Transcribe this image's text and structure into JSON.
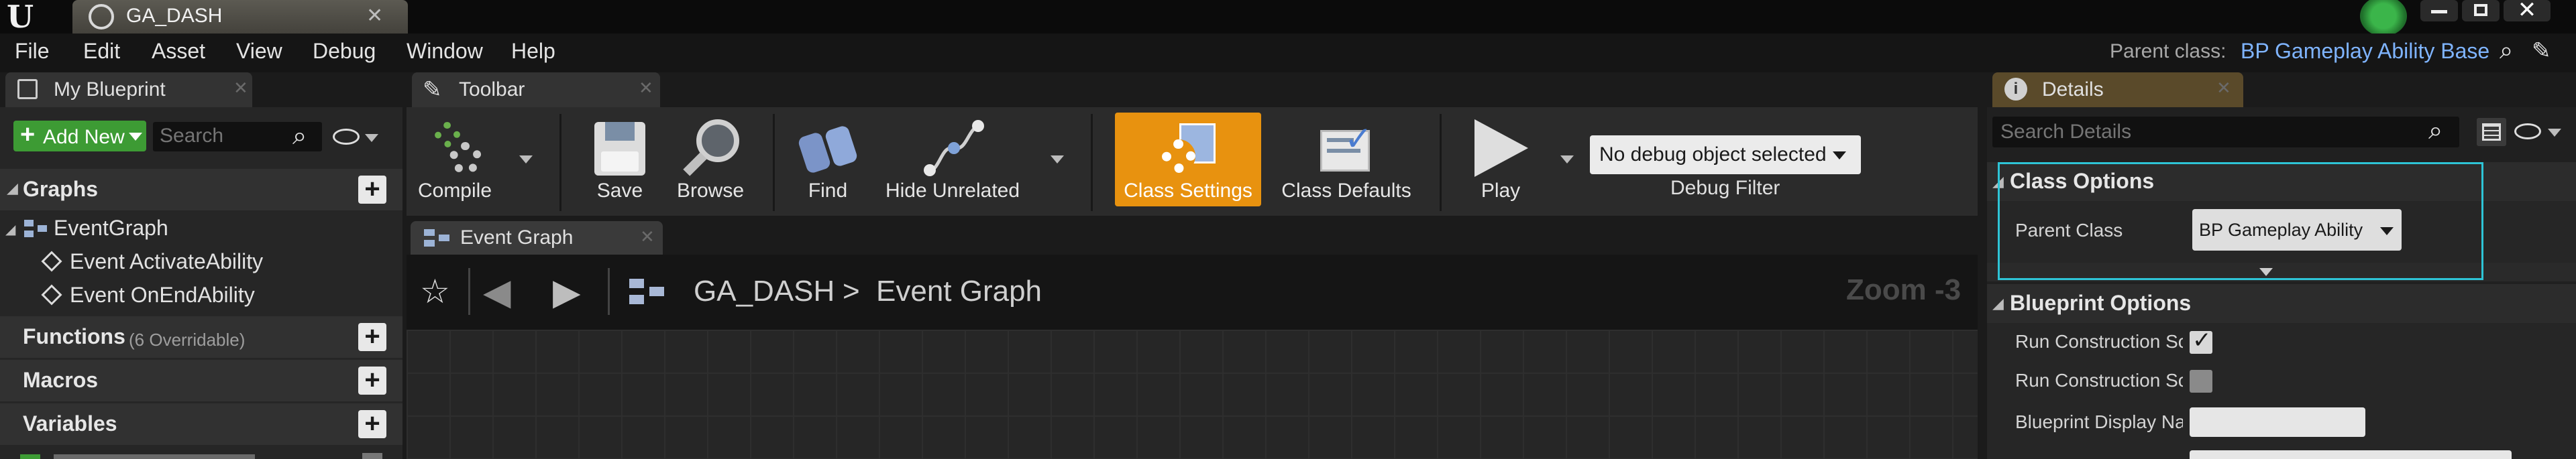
{
  "window": {
    "doc_tab": "GA_DASH",
    "parent_class_label": "Parent class:",
    "parent_class_value": "BP Gameplay Ability Base"
  },
  "menu": {
    "items": [
      "File",
      "Edit",
      "Asset",
      "View",
      "Debug",
      "Window",
      "Help"
    ]
  },
  "my_blueprint": {
    "tab": "My Blueprint",
    "add_new": "Add New",
    "search_placeholder": "Search",
    "graphs": {
      "title": "Graphs",
      "event_graph": "EventGraph",
      "events": [
        "Event ActivateAbility",
        "Event OnEndAbility"
      ]
    },
    "functions": {
      "title": "Functions",
      "count_text": "(6 Overridable)"
    },
    "macros": {
      "title": "Macros"
    },
    "variables": {
      "title": "Variables"
    }
  },
  "toolbar": {
    "tab": "Toolbar",
    "compile": "Compile",
    "save": "Save",
    "browse": "Browse",
    "find": "Find",
    "hide_unrelated": "Hide Unrelated",
    "class_settings": "Class Settings",
    "class_defaults": "Class Defaults",
    "play": "Play",
    "debug_object": "No debug object selected",
    "debug_filter": "Debug Filter"
  },
  "graph_editor": {
    "tab": "Event Graph",
    "crumb_root": "GA_DASH",
    "crumb_sep": ">",
    "crumb_current": "Event Graph",
    "zoom": "Zoom -3"
  },
  "details": {
    "tab": "Details",
    "search_placeholder": "Search Details",
    "class_options": {
      "title": "Class Options",
      "parent_class_label": "Parent Class",
      "parent_class_value": "BP Gameplay Ability"
    },
    "blueprint_options": {
      "title": "Blueprint Options",
      "run_construction_1": "Run Construction Sc",
      "run_construction_2": "Run Construction Sc",
      "display_name": "Blueprint Display Na"
    }
  },
  "colors": {
    "accent_orange": "#e8920f",
    "add_new_green": "#3d9b34",
    "highlight_cyan": "#2ec4d6",
    "link_blue": "#7fb4ff"
  }
}
